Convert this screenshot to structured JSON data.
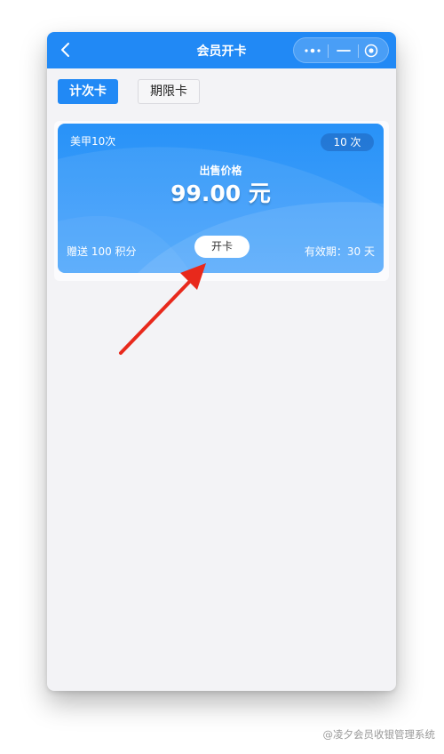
{
  "header": {
    "title": "会员开卡",
    "back_icon": "chevron-left-icon",
    "capsule_icons": [
      "more-dots-icon",
      "minimize-icon",
      "close-target-icon"
    ]
  },
  "tabs": [
    {
      "label": "计次卡",
      "active": true
    },
    {
      "label": "期限卡",
      "active": false
    }
  ],
  "card": {
    "name": "美甲10次",
    "badge": "10 次",
    "price_label": "出售价格",
    "price_value": "99.00 元",
    "bonus": "赠送 100 积分",
    "validity": "有效期：30 天",
    "open_label": "开卡"
  },
  "watermark": "@凌夕会员收银管理系统",
  "colors": {
    "accent": "#2189f5",
    "background": "#f3f3f6",
    "annotation_arrow": "#e8291c"
  }
}
